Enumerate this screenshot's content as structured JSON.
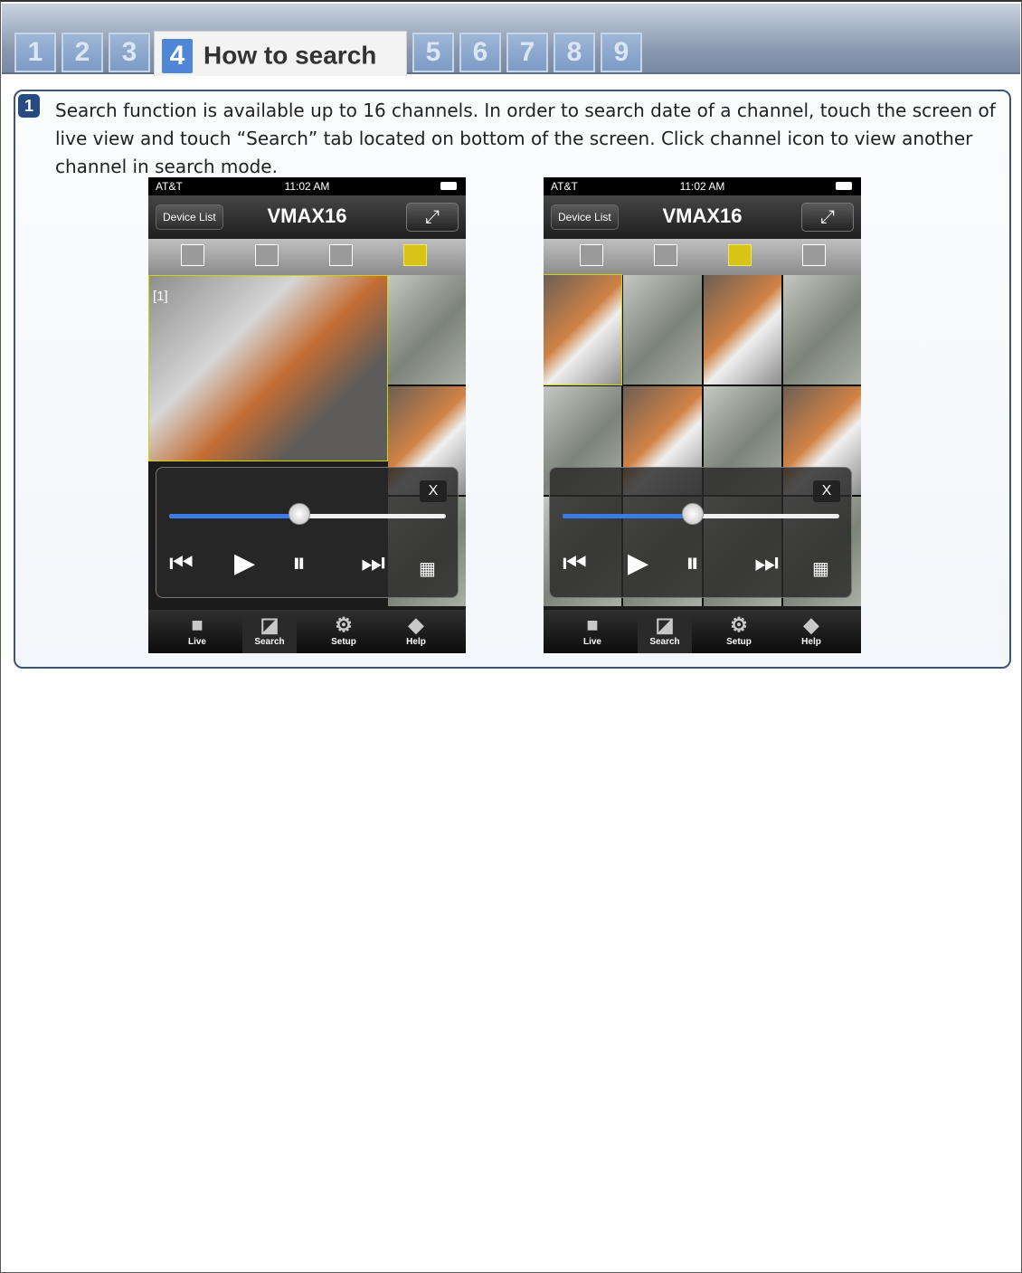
{
  "tabs": [
    {
      "num": "1"
    },
    {
      "num": "2"
    },
    {
      "num": "3"
    },
    {
      "num": "4",
      "title": "How to search"
    },
    {
      "num": "5"
    },
    {
      "num": "6"
    },
    {
      "num": "7"
    },
    {
      "num": "8"
    },
    {
      "num": "9"
    }
  ],
  "step": {
    "number": "1",
    "text": "Search function is available up to 16 channels. In order to search date of a channel, touch the screen  of live view and touch “Search” tab located on bottom of the screen. Click channel icon to view another channel in search mode."
  },
  "phones": [
    {
      "carrier": "AT&T",
      "time": "11:02 AM",
      "device_button": "Device List",
      "title": "VMAX16",
      "channel_label": "[1]",
      "close": "X",
      "slider_progress": 0.47,
      "tabs": [
        "Live",
        "Search",
        "Setup",
        "Help"
      ]
    },
    {
      "carrier": "AT&T",
      "time": "11:02 AM",
      "device_button": "Device List",
      "title": "VMAX16",
      "close": "X",
      "slider_progress": 0.47,
      "tabs": [
        "Live",
        "Search",
        "Setup",
        "Help"
      ]
    }
  ],
  "colors": {
    "accent": "#4f86d6",
    "frame": "#3e5378",
    "slider": "#3a7be8",
    "selected_layout": "#d8c417"
  }
}
